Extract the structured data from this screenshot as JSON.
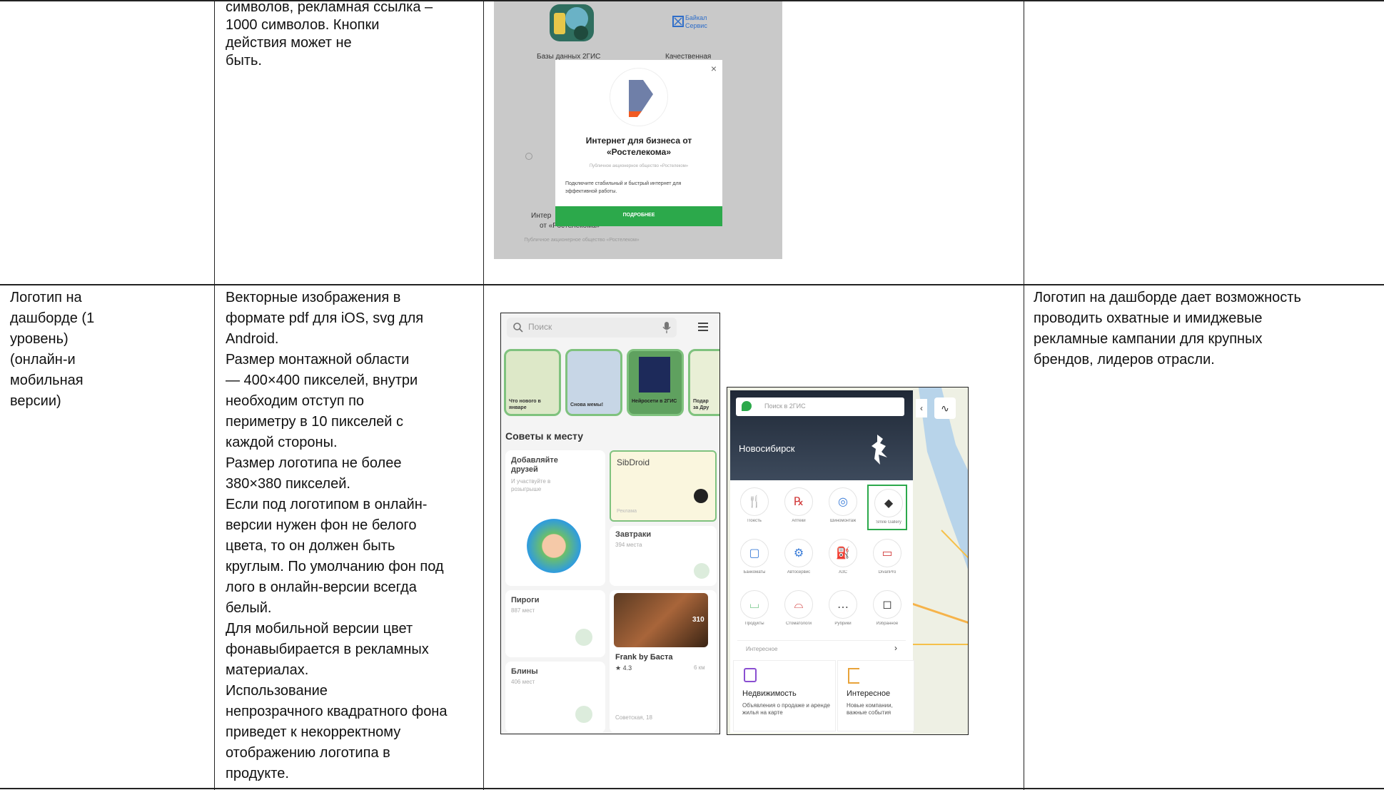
{
  "row1": {
    "col2_lines": [
      "символов, рекламная ссылка –",
      "1000 символов. Кнопки",
      "действия может не",
      "быть."
    ],
    "mockup": {
      "card_left_label": "Базы данных 2ГИС",
      "card_right_brand": "Байкал Сервис",
      "card_right_label": "Качественная",
      "bottom_left_line1": "Интер",
      "bottom_left_line2": "от «Ростелекома»",
      "bottom_left_sub": "Публичное акционерное общество «Ростелеком»",
      "close_symbol": "×",
      "modal_title_1": "Интернет для бизнеса от",
      "modal_title_2": "«Ростелекома»",
      "modal_company": "Публичное акционерное общество «Ростелеком»",
      "modal_text_1": "Подключите стабильный и быстрый интернет для",
      "modal_text_2": "эффективной работы.",
      "modal_button": "ПОДРОБНЕЕ"
    }
  },
  "row2": {
    "col1_lines": [
      "Логотип на",
      "дашборде (1",
      "уровень)",
      "(онлайн-и",
      "мобильная",
      "версии)"
    ],
    "col2_lines": [
      "Векторные изображения в",
      "формате pdf для iOS, svg для",
      "Android.",
      "Размер монтажной области",
      "— 400×400 пикселей, внутри",
      "необходим отступ по",
      "периметру в 10 пикселей с",
      "каждой стороны.",
      "Размер логотипа не более",
      "380×380 пикселей.",
      "Если под логотипом в онлайн-",
      "версии нужен фон не белого",
      "цвета, то он должен быть",
      "круглым. По умолчанию фон под",
      "лого в онлайн-версии всегда",
      "белый.",
      "Для мобильной версии цвет",
      "фонавыбирается в рекламных",
      "материалах.",
      "Использование",
      "непрозрачного квадратного фона",
      "приведет к некорректному",
      "отображению логотипа в",
      "продукте."
    ],
    "col4_lines": [
      "Логотип на дашборде дает возможность",
      "проводить охватные и имиджевые",
      "рекламные кампании для крупных",
      "брендов, лидеров отрасли."
    ],
    "mobile": {
      "search_placeholder": "Поиск",
      "stories": [
        "Что нового в январе",
        "Снова мемы!",
        "Нейросети в 2ГИС",
        "Подар за Дру"
      ],
      "section_title": "Советы к месту",
      "card1_title": "Добавляйте друзей",
      "card1_sub": "И участвуйте в розыгрыше",
      "card2_title": "SibDroid",
      "card2_sub": "Реклама",
      "card3_title": "Завтраки",
      "card3_sub": "394 места",
      "card4_title": "Пироги",
      "card4_sub": "887 мест",
      "card5_title": "Frank by Баста",
      "card5_rating": "★ 4.3",
      "card5_distance": "6 км",
      "card5_addr": "Советская, 18",
      "card5_badge": "310",
      "card6_title": "Блины",
      "card6_sub": "406 мест"
    },
    "web": {
      "search_placeholder": "Поиск в 2ГИС",
      "city": "Новосибирск",
      "categories": [
        "Поесть",
        "Аптеки",
        "Шиномонтаж",
        "Smile Gallery",
        "Банкоматы",
        "Автосервис",
        "АЗС",
        "DivanPro",
        "Продукты",
        "Стоматологи",
        "Рубрики",
        "Избранное"
      ],
      "interesting_label": "Интересное",
      "card1_title": "Недвижимость",
      "card1_text": "Объявления о продаже и аренде жилья на карте",
      "card2_title": "Интересное",
      "card2_text": "Новые компании, важные события"
    }
  },
  "colors": {
    "accent_green": "#2ca94b",
    "rostelecom_orange": "#f05a22",
    "map_water": "#b8d4ea",
    "city_header": "#2b3442"
  }
}
